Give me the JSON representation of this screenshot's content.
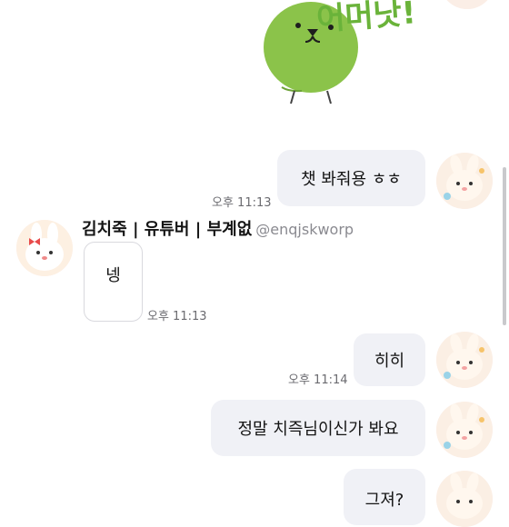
{
  "sticker": {
    "text": "어머낫!"
  },
  "messages": [
    {
      "id": "m1",
      "direction": "out",
      "text": "챗 봐줘용 ㅎㅎ",
      "time": "오후 11:13"
    },
    {
      "id": "m2",
      "direction": "in",
      "sender_name": "김치죽 | 유튜버 | 부계없",
      "sender_handle": "@enqjskworp",
      "text": "넹",
      "time": "오후 11:13"
    },
    {
      "id": "m3",
      "direction": "out",
      "text": "히히",
      "time": "오후 11:14"
    },
    {
      "id": "m4",
      "direction": "out",
      "text": "정말 치즉님이신가 봐요",
      "time": ""
    },
    {
      "id": "m5",
      "direction": "out",
      "text": "그져?",
      "time": ""
    }
  ],
  "colors": {
    "sticker_green": "#8bc34a",
    "bubble_out": "#f0f1f6",
    "text": "#141414",
    "time": "#6b6b70"
  }
}
